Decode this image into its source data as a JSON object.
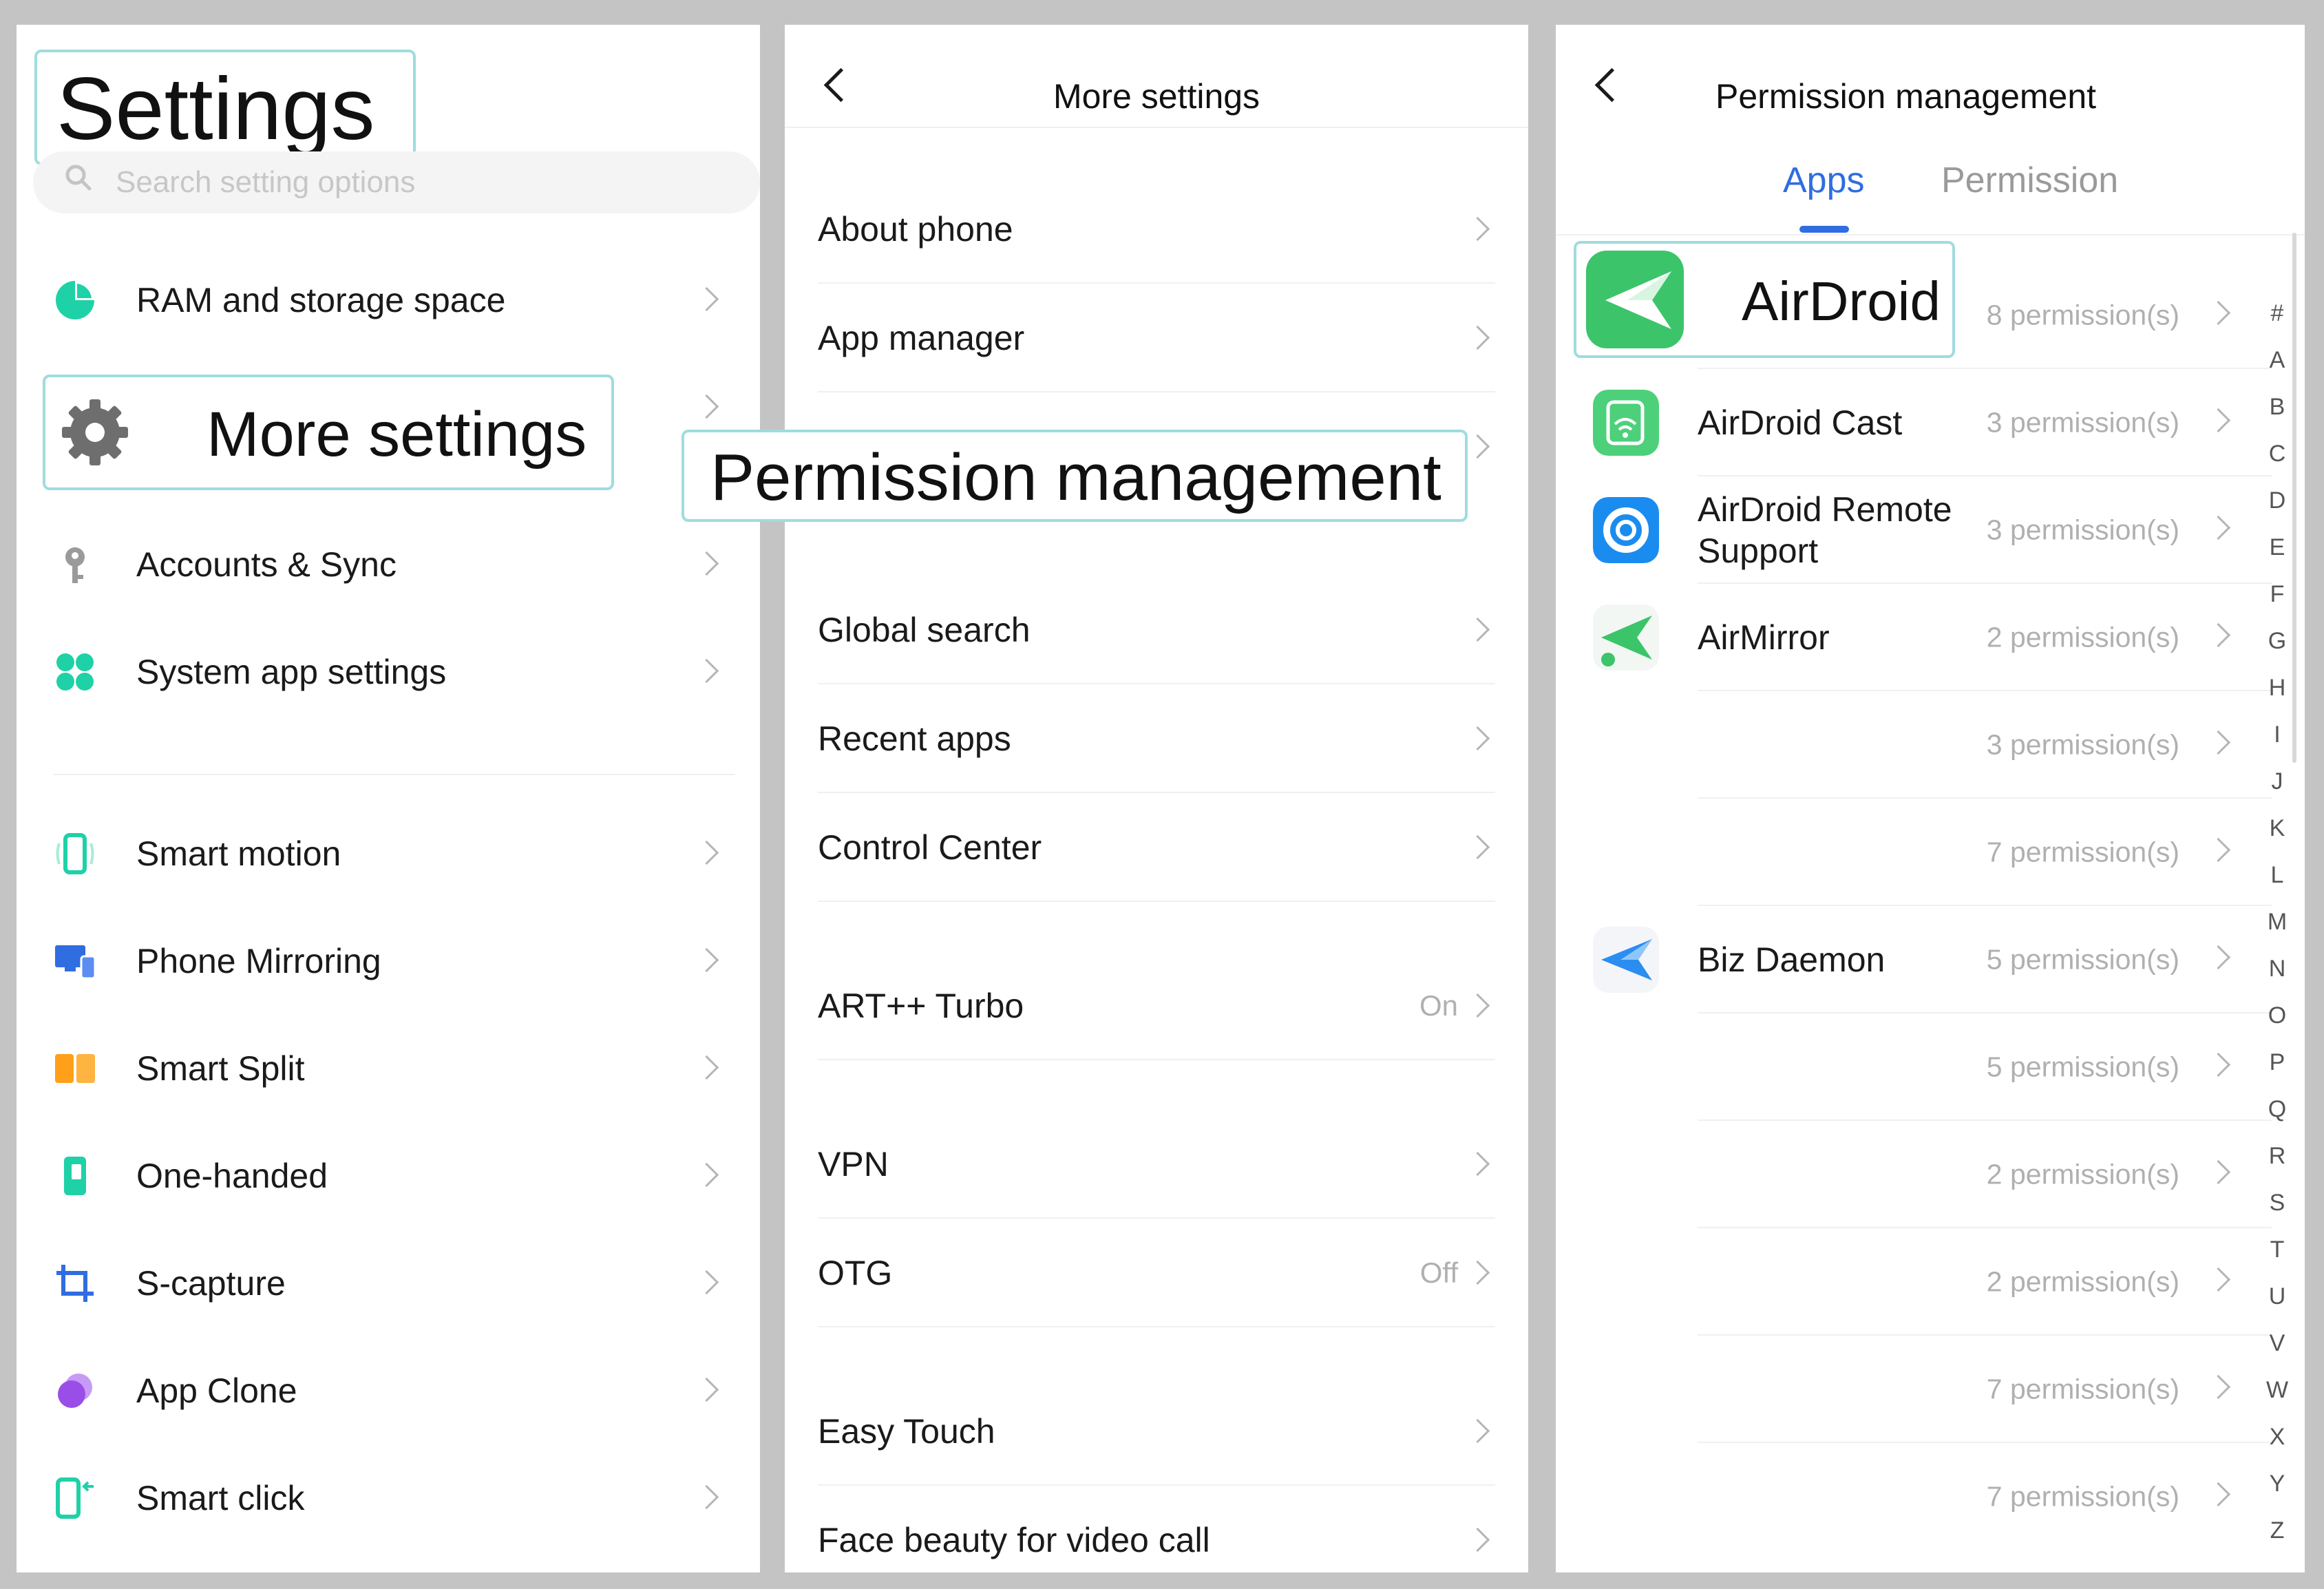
{
  "settings": {
    "title": "Settings",
    "search_placeholder": "Search setting options",
    "items": [
      {
        "label": "RAM and storage space",
        "icon": "pie-chart-icon"
      },
      {
        "label": "More settings",
        "icon": "gear-icon"
      },
      {
        "label": "Accounts & Sync",
        "icon": "key-icon"
      },
      {
        "label": "System app settings",
        "icon": "four-dots-icon"
      },
      {
        "label": "Smart motion",
        "icon": "phone-motion-icon"
      },
      {
        "label": "Phone Mirroring",
        "icon": "mirror-devices-icon"
      },
      {
        "label": "Smart Split",
        "icon": "split-screen-icon"
      },
      {
        "label": "One-handed",
        "icon": "one-handed-icon"
      },
      {
        "label": "S-capture",
        "icon": "crop-icon"
      },
      {
        "label": "App Clone",
        "icon": "app-clone-icon"
      },
      {
        "label": "Smart click",
        "icon": "smart-click-icon"
      }
    ]
  },
  "more_settings": {
    "title": "More settings",
    "callout": "Permission management",
    "items": [
      {
        "label": "About phone",
        "value": ""
      },
      {
        "label": "App manager",
        "value": ""
      },
      {
        "label": "Global search",
        "value": ""
      },
      {
        "label": "Recent apps",
        "value": ""
      },
      {
        "label": "Control Center",
        "value": ""
      },
      {
        "label": "ART++ Turbo",
        "value": "On"
      },
      {
        "label": "VPN",
        "value": ""
      },
      {
        "label": "OTG",
        "value": "Off"
      },
      {
        "label": "Easy Touch",
        "value": ""
      },
      {
        "label": "Face beauty for video call",
        "value": ""
      }
    ]
  },
  "permission": {
    "title": "Permission management",
    "tabs": [
      "Apps",
      "Permission"
    ],
    "active_tab": "Apps",
    "apps": [
      {
        "name": "AirDroid",
        "count": "8 permission(s)"
      },
      {
        "name": "AirDroid Cast",
        "count": "3 permission(s)"
      },
      {
        "name": "AirDroid Remote Support",
        "count": "3 permission(s)"
      },
      {
        "name": "AirMirror",
        "count": "2 permission(s)"
      },
      {
        "name": "",
        "count": "3 permission(s)"
      },
      {
        "name": "",
        "count": "7 permission(s)"
      },
      {
        "name": "Biz Daemon",
        "count": "5 permission(s)"
      },
      {
        "name": "",
        "count": "5 permission(s)"
      },
      {
        "name": "",
        "count": "2 permission(s)"
      },
      {
        "name": "",
        "count": "2 permission(s)"
      },
      {
        "name": "",
        "count": "7 permission(s)"
      },
      {
        "name": "",
        "count": "7 permission(s)"
      }
    ],
    "alphabet": [
      "#",
      "A",
      "B",
      "C",
      "D",
      "E",
      "F",
      "G",
      "H",
      "I",
      "J",
      "K",
      "L",
      "M",
      "N",
      "O",
      "P",
      "Q",
      "R",
      "S",
      "T",
      "U",
      "V",
      "W",
      "X",
      "Y",
      "Z"
    ]
  },
  "colors": {
    "accent": "#2f6de1",
    "highlight_border": "#9fdcdf",
    "teal": "#1fd1a7",
    "airdroid_green": "#3cc46a"
  }
}
